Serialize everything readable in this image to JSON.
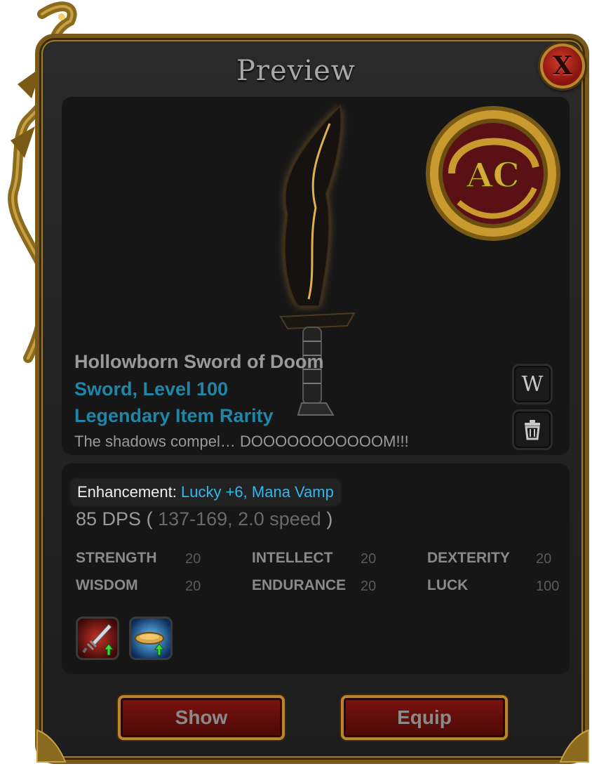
{
  "window": {
    "title": "Preview",
    "close_label": "X"
  },
  "item": {
    "name": "Hollowborn Sword of Doom",
    "type_level": "Sword, Level 100",
    "rarity": "Legendary Item Rarity",
    "description": "The shadows compel… DOOOOOOOOOOOM!!!",
    "badge_text": "AC"
  },
  "side_buttons": {
    "wiki_label": "W",
    "trash_icon": "trash-icon"
  },
  "enhancement": {
    "label": "Enhancement:",
    "value": "Lucky +6, Mana Vamp"
  },
  "damage": {
    "dps": "85 DPS",
    "open": "(",
    "range": "137-169, 2.0 speed",
    "close": ")"
  },
  "stats": [
    {
      "name": "STRENGTH",
      "value": "20"
    },
    {
      "name": "INTELLECT",
      "value": "20"
    },
    {
      "name": "DEXTERITY",
      "value": "20"
    },
    {
      "name": "WISDOM",
      "value": "20"
    },
    {
      "name": "ENDURANCE",
      "value": "20"
    },
    {
      "name": "LUCK",
      "value": "100"
    }
  ],
  "skills": [
    {
      "icon": "sword-upgrade-icon"
    },
    {
      "icon": "boost-upgrade-icon"
    }
  ],
  "actions": {
    "show_label": "Show",
    "equip_label": "Equip"
  },
  "colors": {
    "frame_gold": "#b8862e",
    "button_red": "#7a1410",
    "accent_blue": "#1f86a8",
    "enhancement_blue": "#2db8f0"
  }
}
